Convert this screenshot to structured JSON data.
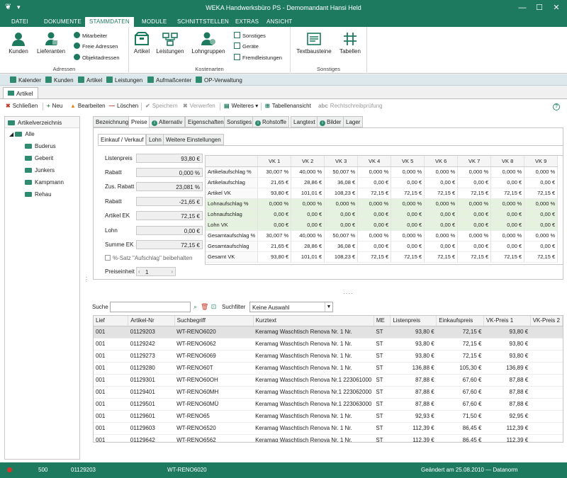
{
  "window": {
    "title": "WEKA Handwerksbüro PS - Demomandant Hansi Held",
    "minimize": "—",
    "maximize": "☐",
    "close": "✕"
  },
  "menu": {
    "items": [
      "DATEI",
      "DOKUMENTE",
      "STAMMDATEN",
      "MODULE",
      "SCHNITTSTELLEN",
      "EXTRAS",
      "ANSICHT"
    ],
    "active": "STAMMDATEN"
  },
  "ribbon": {
    "groups": {
      "adressen": "Adressen",
      "kostenarten": "Kostenarten",
      "sonstiges": "Sonstiges"
    },
    "kunden": "Kunden",
    "lieferanten": "Lieferanten",
    "mitarbeiter": "Mitarbeiter",
    "freie_adressen": "Freie Adressen",
    "objektadressen": "Objektadressen",
    "artikel": "Artikel",
    "leistungen": "Leistungen",
    "lohngruppen": "Lohngruppen",
    "sonstiges": "Sonstiges",
    "geraete": "Geräte",
    "fremdleistungen": "Fremdleistungen",
    "textbausteine": "Textbausteine",
    "tabellen": "Tabellen"
  },
  "quickbar": [
    "Kalender",
    "Kunden",
    "Artikel",
    "Leistungen",
    "Aufmaßcenter",
    "OP-Verwaltung"
  ],
  "doc_tab": "Artikel",
  "toolbar": {
    "schliessen": "Schließen",
    "neu": "Neu",
    "bearbeiten": "Bearbeiten",
    "loeschen": "Löschen",
    "speichern": "Speichern",
    "verwerfen": "Verwerfen",
    "weiteres": "Weiteres",
    "tabellenansicht": "Tabellenansicht",
    "rechtschreib": "Rechtschreibprüfung",
    "help": "?"
  },
  "tree": {
    "header": "Artikelverzeichnis",
    "root": "Alle",
    "children": [
      "Buderus",
      "Geberit",
      "Junkers",
      "Kampmann",
      "Rehau"
    ]
  },
  "tabs": [
    "Bezeichnung",
    "Preise",
    "Alternativ",
    "Eigenschaften",
    "Sonstiges",
    "Rohstoffe",
    "Langtext",
    "Bilder",
    "Lager"
  ],
  "subtabs": [
    "Einkauf / Verkauf",
    "Lohn",
    "Weitere Einstellungen"
  ],
  "fields": [
    {
      "label": "Listenpreis",
      "value": "93,80 €"
    },
    {
      "label": "Rabatt",
      "value": "0,000 %"
    },
    {
      "label": "Zus. Rabatt",
      "value": "23,081 %"
    },
    {
      "label": "Rabatt",
      "value": "-21,65 €"
    },
    {
      "label": "Artikel EK",
      "value": "72,15 €"
    },
    {
      "label": "Lohn",
      "value": "0,00 €"
    },
    {
      "label": "Summe EK",
      "value": "72,15 €"
    }
  ],
  "checkbox_label": "%-Satz \"Aufschlag\" beibehalten",
  "preiseinheit": {
    "label": "Preiseinheit",
    "value": "1",
    "dec": "‹",
    "inc": "›"
  },
  "vk_grid": {
    "columns": [
      "VK 1",
      "VK 2",
      "VK 3",
      "VK 4",
      "VK 5",
      "VK 6",
      "VK 7",
      "VK 8",
      "VK 9"
    ],
    "rows": [
      {
        "label": "Artikelaufschlag %",
        "values": [
          "30,007 %",
          "40,000 %",
          "50,007 %",
          "0,000 %",
          "0,000 %",
          "0,000 %",
          "0,000 %",
          "0,000 %",
          "0,000 %"
        ]
      },
      {
        "label": "Artikelaufschlag",
        "values": [
          "21,65 €",
          "28,86 €",
          "36,08 €",
          "0,00 €",
          "0,00 €",
          "0,00 €",
          "0,00 €",
          "0,00 €",
          "0,00 €"
        ]
      },
      {
        "label": "Artikel VK",
        "values": [
          "93,80 €",
          "101,01 €",
          "108,23 €",
          "72,15 €",
          "72,15 €",
          "72,15 €",
          "72,15 €",
          "72,15 €",
          "72,15 €"
        ]
      },
      {
        "label": "Lohnaufschlag %",
        "values": [
          "0,000 %",
          "0,000 %",
          "0,000 %",
          "0,000 %",
          "0,000 %",
          "0,000 %",
          "0,000 %",
          "0,000 %",
          "0,000 %"
        ]
      },
      {
        "label": "Lohnaufschlag",
        "values": [
          "0,00 €",
          "0,00 €",
          "0,00 €",
          "0,00 €",
          "0,00 €",
          "0,00 €",
          "0,00 €",
          "0,00 €",
          "0,00 €"
        ]
      },
      {
        "label": "Lohn VK",
        "values": [
          "0,00 €",
          "0,00 €",
          "0,00 €",
          "0,00 €",
          "0,00 €",
          "0,00 €",
          "0,00 €",
          "0,00 €",
          "0,00 €"
        ]
      },
      {
        "label": "Gesamtaufschlag %",
        "values": [
          "30,007 %",
          "40,000 %",
          "50,007 %",
          "0,000 %",
          "0,000 %",
          "0,000 %",
          "0,000 %",
          "0,000 %",
          "0,000 %"
        ]
      },
      {
        "label": "Gesamtaufschlag",
        "values": [
          "21,65 €",
          "28,86 €",
          "36,08 €",
          "0,00 €",
          "0,00 €",
          "0,00 €",
          "0,00 €",
          "0,00 €",
          "0,00 €"
        ]
      },
      {
        "label": "Gesamt VK",
        "values": [
          "93,80 €",
          "101,01 €",
          "108,23 €",
          "72,15 €",
          "72,15 €",
          "72,15 €",
          "72,15 €",
          "72,15 €",
          "72,15 €"
        ]
      }
    ],
    "green_rows": [
      3,
      4,
      5
    ]
  },
  "search": {
    "label": "Suche",
    "value": "",
    "filter_label": "Suchfilter",
    "filter_value": "Keine Auswahl"
  },
  "list": {
    "columns": [
      "Lief",
      "Artikel-Nr",
      "Suchbegriff",
      "Kurztext",
      "ME",
      "Listenpreis",
      "Einkaufspreis",
      "VK-Preis 1",
      "VK-Preis 2"
    ],
    "rows": [
      [
        "001",
        "01129203",
        "WT-RENO6020",
        "Keramag Waschtisch Renova Nr. 1   Nr.",
        "ST",
        "93,80 €",
        "72,15 €",
        "93,80 €"
      ],
      [
        "001",
        "01129242",
        "WT-RENO6062",
        "Keramag Waschtisch Renova Nr. 1   Nr.",
        "ST",
        "93,80 €",
        "72,15 €",
        "93,80 €"
      ],
      [
        "001",
        "01129273",
        "WT-RENO6069",
        "Keramag Waschtisch Renova Nr. 1   Nr.",
        "ST",
        "93,80 €",
        "72,15 €",
        "93,80 €"
      ],
      [
        "001",
        "01129280",
        "WT-RENO60T",
        "Keramag Waschtisch Renova Nr. 1   Nr.",
        "ST",
        "136,88 €",
        "105,30 €",
        "136,89 €"
      ],
      [
        "001",
        "01129301",
        "WT-RENO60OH",
        "Keramag Waschtisch Renova Nr.1 223061000",
        "ST",
        "87,88 €",
        "67,60 €",
        "87,88 €"
      ],
      [
        "001",
        "01129401",
        "WT-RENO60MH",
        "Keramag Waschtisch Renova Nr.1 223062000",
        "ST",
        "87,88 €",
        "67,60 €",
        "87,88 €"
      ],
      [
        "001",
        "01129501",
        "WT-RENO60MÜ",
        "Keramag Waschtisch Renova Nr.1 223063000",
        "ST",
        "87,88 €",
        "67,60 €",
        "87,88 €"
      ],
      [
        "001",
        "01129601",
        "WT-RENO65",
        "Keramag Waschtisch Renova Nr. 1   Nr.",
        "ST",
        "92,93 €",
        "71,50 €",
        "92,95 €"
      ],
      [
        "001",
        "01129603",
        "WT-RENO6520",
        "Keramag Waschtisch Renova Nr. 1   Nr.",
        "ST",
        "112,39 €",
        "86,45 €",
        "112,39 €"
      ],
      [
        "001",
        "01129642",
        "WT-RENO6562",
        "Keramag Waschtisch Renova Nr. 1   Nr.",
        "ST",
        "112,39 €",
        "86,45 €",
        "112,39 €"
      ]
    ]
  },
  "status": {
    "left": "500",
    "artnr": "01129203",
    "such": "WT-RENO6020",
    "changed": "Geändert am 25.08.2010 — Datanorm"
  },
  "colors": {
    "brand": "#1d7a5f",
    "green_row": "#e6f2e0",
    "status_dot": "#d9342b"
  }
}
